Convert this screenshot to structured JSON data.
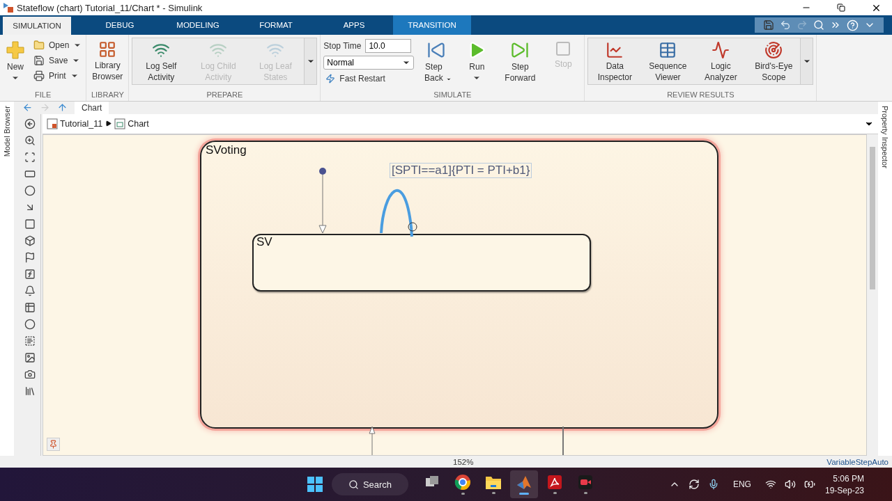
{
  "window": {
    "title": "Stateflow (chart) Tutorial_11/Chart * - Simulink"
  },
  "tabs": [
    {
      "label": "SIMULATION",
      "selected": true,
      "kind": "standard"
    },
    {
      "label": "DEBUG",
      "selected": false,
      "kind": "standard"
    },
    {
      "label": "MODELING",
      "selected": false,
      "kind": "standard"
    },
    {
      "label": "FORMAT",
      "selected": false,
      "kind": "standard"
    },
    {
      "label": "APPS",
      "selected": false,
      "kind": "standard"
    },
    {
      "label": "TRANSITION",
      "selected": false,
      "kind": "contextual"
    }
  ],
  "ribbon": [
    {
      "title": "FILE",
      "gallery": false,
      "items": [
        {
          "kind": "large",
          "label": "New",
          "dropdown": true,
          "disabled": false
        },
        {
          "kind": "small",
          "label": "Open",
          "dropdown": true,
          "disabled": false
        },
        {
          "kind": "small",
          "label": "Save",
          "dropdown": true,
          "disabled": false
        },
        {
          "kind": "small",
          "label": "Print",
          "dropdown": true,
          "disabled": false
        }
      ]
    },
    {
      "title": "LIBRARY",
      "gallery": false,
      "items": [
        {
          "kind": "large",
          "label": "Library Browser",
          "dropdown": false,
          "disabled": false
        }
      ]
    },
    {
      "title": "PREPARE",
      "gallery": true,
      "items": [
        {
          "kind": "large",
          "label": "Log Self Activity",
          "dropdown": false,
          "disabled": false
        },
        {
          "kind": "large",
          "label": "Log Child Activity",
          "dropdown": false,
          "disabled": true
        },
        {
          "kind": "large",
          "label": "Log Leaf States",
          "dropdown": false,
          "disabled": true
        }
      ]
    },
    {
      "title": "SIMULATE",
      "gallery": false,
      "items": [
        {
          "kind": "field",
          "label": "Stop Time",
          "value": "10.0"
        },
        {
          "kind": "select",
          "value": "Normal"
        },
        {
          "kind": "toggle",
          "label": "Fast Restart",
          "on": false
        },
        {
          "kind": "large",
          "label": "Step Back",
          "dropdown": true,
          "disabled": false
        },
        {
          "kind": "large",
          "label": "Run",
          "dropdown": true,
          "disabled": false
        },
        {
          "kind": "large",
          "label": "Step Forward",
          "dropdown": false,
          "disabled": false
        },
        {
          "kind": "large",
          "label": "Stop",
          "dropdown": false,
          "disabled": true
        }
      ]
    },
    {
      "title": "REVIEW RESULTS",
      "gallery": true,
      "items": [
        {
          "kind": "large",
          "label": "Data Inspector",
          "dropdown": false,
          "disabled": false
        },
        {
          "kind": "large",
          "label": "Sequence Viewer",
          "dropdown": false,
          "disabled": false
        },
        {
          "kind": "large",
          "label": "Logic Analyzer",
          "dropdown": false,
          "disabled": false
        },
        {
          "kind": "large",
          "label": "Bird's-Eye Scope",
          "dropdown": false,
          "disabled": false
        }
      ]
    }
  ],
  "side_tabs": {
    "left": "Model Browser",
    "right": "Property Inspector"
  },
  "editor_tab": "Chart",
  "breadcrumb": [
    "Tutorial_11",
    "Chart"
  ],
  "chart": {
    "states": [
      {
        "name": "SVoting",
        "highlighted": true,
        "children": [
          {
            "name": "SV",
            "highlighted": false
          }
        ]
      }
    ],
    "transitions": [
      {
        "kind": "default",
        "selected": false
      },
      {
        "kind": "self_loop",
        "label": "[SPTI==a1]{PTI = PTI+b1}",
        "selected": true
      },
      {
        "kind": "exit_in",
        "selected": false
      },
      {
        "kind": "exit_out",
        "selected": false
      }
    ]
  },
  "status_bar": {
    "zoom": "152%",
    "solver": "VariableStepAuto"
  },
  "taskbar": {
    "search": "Search",
    "apps": [
      {
        "running": false,
        "selected": false
      },
      {
        "running": true,
        "selected": false
      },
      {
        "running": true,
        "selected": false
      },
      {
        "running": true,
        "selected": true
      },
      {
        "running": true,
        "selected": false
      },
      {
        "running": true,
        "selected": false
      }
    ],
    "language": "ENG",
    "time": "5:06 PM",
    "date": "19-Sep-23"
  }
}
